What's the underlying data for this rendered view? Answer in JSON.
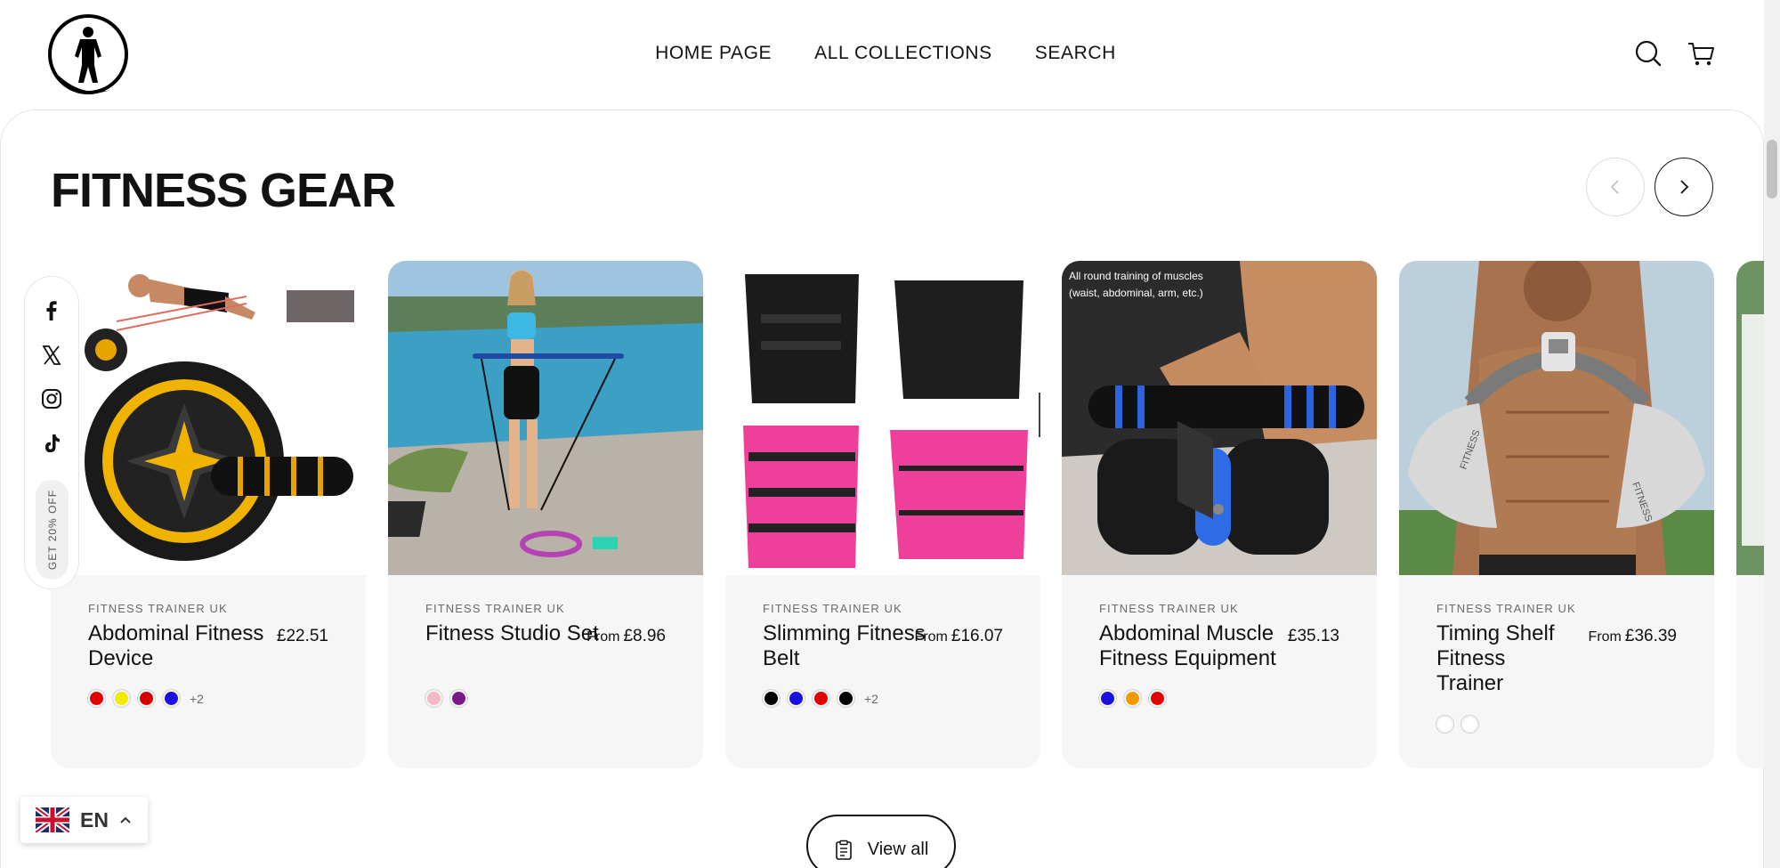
{
  "header": {
    "logo": "fitness-trainer-logo",
    "nav": [
      {
        "label": "HOME PAGE"
      },
      {
        "label": "ALL COLLECTIONS"
      },
      {
        "label": "SEARCH"
      }
    ],
    "icons": [
      "search-icon",
      "cart-icon"
    ]
  },
  "section": {
    "title": "FITNESS GEAR",
    "view_all_label": "View all"
  },
  "products": [
    {
      "vendor": "FITNESS TRAINER UK",
      "title": "Abdominal Fitness Device",
      "price_prefix": "",
      "price": "£22.51",
      "swatches": [
        "#e00000",
        "#f2ea00",
        "#d40000",
        "#1a10e0"
      ],
      "more": "+2"
    },
    {
      "vendor": "FITNESS TRAINER UK",
      "title": "Fitness Studio Set",
      "price_prefix": "From",
      "price": "£8.96",
      "swatches": [
        "#f5b8c8",
        "#7a1a86"
      ],
      "more": ""
    },
    {
      "vendor": "FITNESS TRAINER UK",
      "title": "Slimming Fitness Belt",
      "price_prefix": "From",
      "price": "£16.07",
      "swatches": [
        "#000000",
        "#1a10e0",
        "#e00000",
        "#000000"
      ],
      "more": "+2"
    },
    {
      "vendor": "FITNESS TRAINER UK",
      "title": "Abdominal Muscle Fitness Equipment",
      "price_prefix": "",
      "price": "£35.13",
      "swatches": [
        "#1a10e0",
        "#f19a00",
        "#e00000"
      ],
      "more": ""
    },
    {
      "vendor": "FITNESS TRAINER UK",
      "title": "Timing Shelf Fitness Trainer",
      "price_prefix": "From",
      "price": "£36.39",
      "swatches": [
        "#ffffff",
        "#ffffff"
      ],
      "more": ""
    }
  ],
  "image_captions": {
    "card4_line1": "All round training of muscles",
    "card4_line2": "(waist, abdominal, arm, etc.)",
    "card5_brand": "FITNESS"
  },
  "social": {
    "icons": [
      "facebook-icon",
      "x-icon",
      "instagram-icon",
      "tiktok-icon"
    ],
    "promo": "GET 20% OFF"
  },
  "language": {
    "code": "EN",
    "flag": "uk-flag-icon"
  }
}
